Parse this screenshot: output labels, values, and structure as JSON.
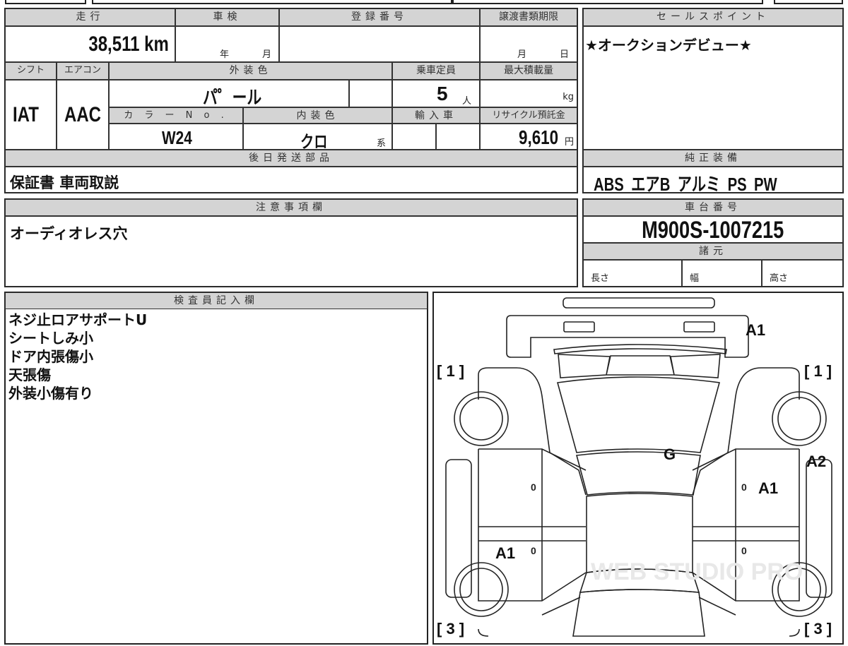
{
  "mileage": {
    "label": "走行",
    "value": "38,511",
    "unit": "km"
  },
  "shaken": {
    "label": "車検",
    "year_unit": "年",
    "month_unit": "月"
  },
  "registration": {
    "label": "登録番号",
    "value": ""
  },
  "transfer_deadline": {
    "label": "譲渡書類期限",
    "month_unit": "月",
    "day_unit": "日"
  },
  "shift": {
    "label": "シフト",
    "value": "IAT"
  },
  "aircon": {
    "label": "エアコン",
    "value": "AAC"
  },
  "exterior_color": {
    "label": "外装色",
    "value": "パ゜ール"
  },
  "capacity": {
    "label": "乗車定員",
    "value": "5",
    "unit": "人"
  },
  "max_load": {
    "label": "最大積載量",
    "unit": "kg"
  },
  "color_no": {
    "label": "カ ラ ー N o .",
    "value": "W24"
  },
  "interior_color": {
    "label": "内装色",
    "value": "クロ",
    "suffix": "系"
  },
  "import": {
    "label": "輸入車"
  },
  "recycle": {
    "label": "リサイクル預託金",
    "value": "9,610",
    "unit": "円"
  },
  "later_parts": {
    "label": "後日発送部品",
    "value": "保証書 車両取説"
  },
  "sales_point": {
    "label": "セールスポイント",
    "value": "★オークションデビュー★"
  },
  "equipment": {
    "label": "純正装備",
    "value": "ABS エアB アルミ PS PW"
  },
  "notes": {
    "label": "注意事項欄",
    "value": "オーディオレス穴"
  },
  "chassis": {
    "label": "車台番号",
    "value": "M900S-1007215"
  },
  "specs": {
    "label": "諸元",
    "length": "長さ",
    "width": "幅",
    "height": "高さ"
  },
  "inspector": {
    "label": "検査員記入欄",
    "lines": [
      "ネジ止ロアサポートU",
      "シートしみ小",
      "ドア内張傷小",
      "天張傷",
      "外装小傷有り"
    ]
  },
  "diagram": {
    "bracket_fl": "[ 1 ]",
    "bracket_fr": "[ 1 ]",
    "bracket_rl": "[ 3 ]",
    "bracket_rr": "[ 3 ]",
    "marks": {
      "front": "A1",
      "windshield": "G",
      "right_rail": "A2",
      "right_front_door": "A1",
      "left_rear_door": "A1"
    },
    "zero": "0",
    "watermark": "WEB STUDIO PRO"
  }
}
